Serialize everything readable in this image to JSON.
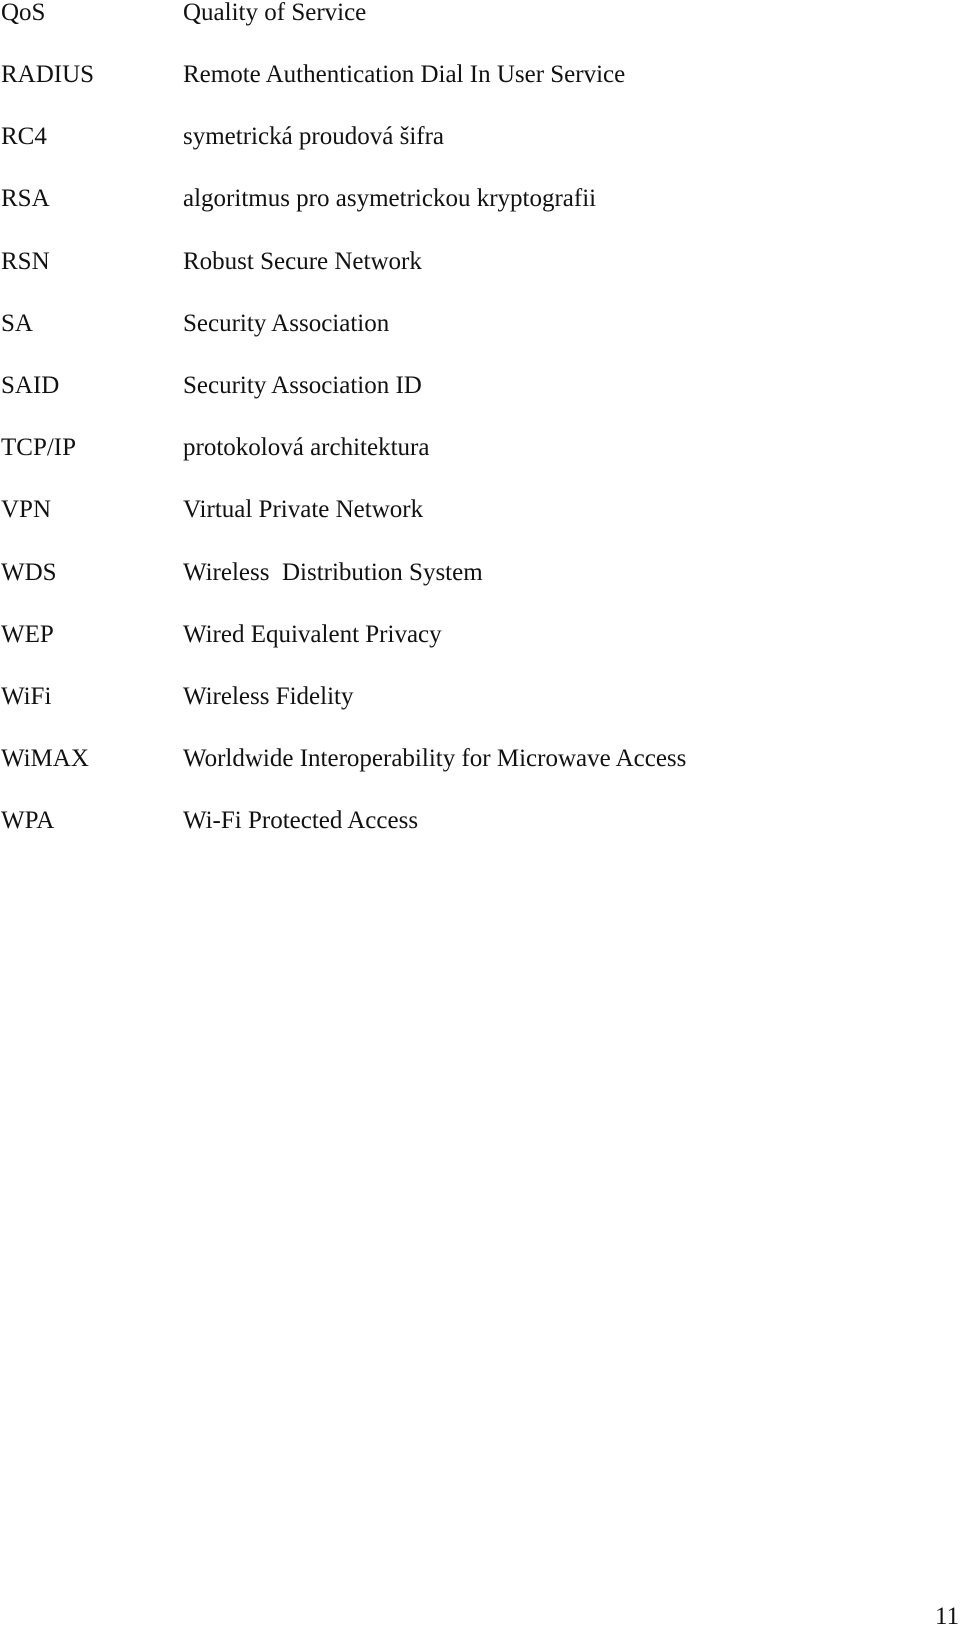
{
  "document": {
    "abbreviations": [
      {
        "term": "QoS",
        "definition": "Quality of Service"
      },
      {
        "term": "RADIUS",
        "definition": "Remote Authentication Dial In User Service"
      },
      {
        "term": "RC4",
        "definition": "symetrická proudová šifra"
      },
      {
        "term": "RSA",
        "definition": "algoritmus pro asymetrickou kryptografii"
      },
      {
        "term": "RSN",
        "definition": "Robust Secure Network"
      },
      {
        "term": "SA",
        "definition": "Security Association"
      },
      {
        "term": "SAID",
        "definition": "Security Association ID"
      },
      {
        "term": "TCP/IP",
        "definition": "protokolová architektura"
      },
      {
        "term": "VPN",
        "definition": "Virtual Private Network"
      },
      {
        "term": "WDS",
        "definition": "Wireless  Distribution System"
      },
      {
        "term": "WEP",
        "definition": "Wired Equivalent Privacy"
      },
      {
        "term": "WiFi",
        "definition": "Wireless Fidelity"
      },
      {
        "term": "WiMAX",
        "definition": "Worldwide Interoperability for Microwave Access"
      },
      {
        "term": "WPA",
        "definition": "Wi-Fi Protected Access"
      }
    ],
    "page_number": "11"
  }
}
